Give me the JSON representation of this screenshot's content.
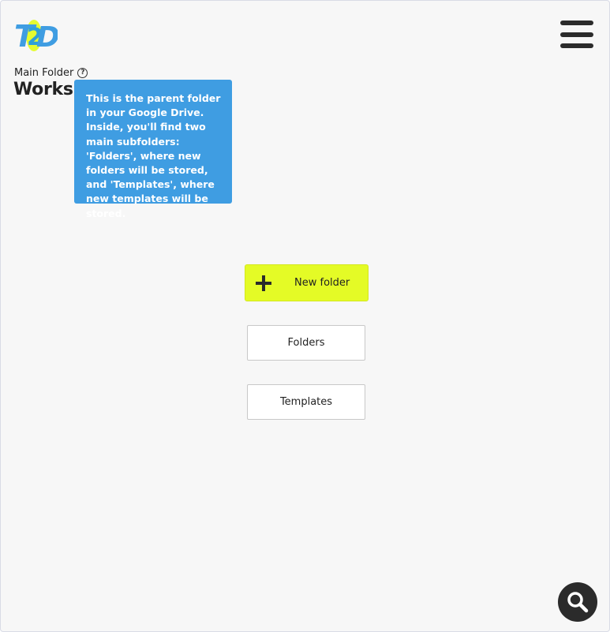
{
  "header": {
    "logo_text": "T2D",
    "menu_icon": "hamburger-menu-icon"
  },
  "folder": {
    "label": "Main Folder",
    "help_icon": "question-circle-icon",
    "help_glyph": "?",
    "title": "Worksp"
  },
  "tooltip": {
    "text": "This is the parent folder in your Google Drive. Inside, you'll find two main subfolders: 'Folders', where new folders will be stored, and 'Templates', where new templates will be stored."
  },
  "actions": {
    "new_folder": {
      "label": "New folder",
      "icon": "plus-icon"
    },
    "folders": {
      "label": "Folders"
    },
    "templates": {
      "label": "Templates"
    }
  },
  "fab": {
    "icon": "search-icon"
  },
  "colors": {
    "background": "#f7f7f7",
    "accent_yellow": "#e4fb26",
    "tooltip_blue": "#3f9de2",
    "logo_blue": "#3f9de2",
    "dark": "#2b2b2b"
  }
}
